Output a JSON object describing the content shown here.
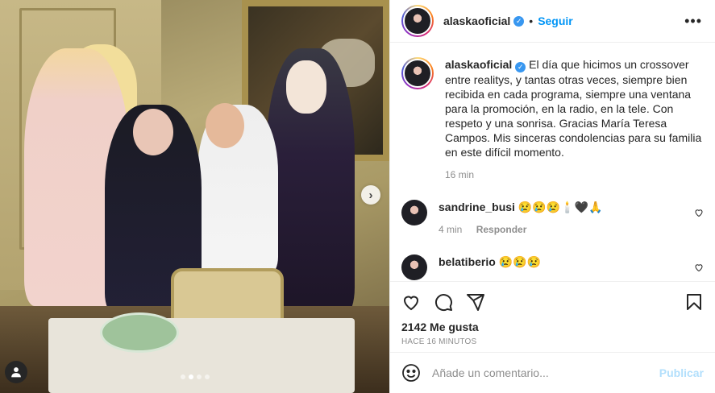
{
  "post": {
    "username": "alaskaoficial",
    "follow_label": "Seguir",
    "separator": "•",
    "more": "•••",
    "caption": "El día que hicimos un crossover entre realitys, y tantas otras veces, siempre bien recibida en cada programa, siempre una ventana para la promoción, en la radio, en la tele. Con respeto y una sonrisa. Gracias María Teresa Campos. Mis sinceras condolencias para su familia en este difícil momento.",
    "caption_time": "16 min",
    "likes": "2142 Me gusta",
    "posted": "HACE 16 MINUTOS",
    "carousel_next": "›",
    "slide_count": 4,
    "active_slide": 2
  },
  "comments": [
    {
      "username": "sandrine_busi",
      "text": "😢😢😢🕯️🖤🙏",
      "time": "4 min",
      "reply_label": "Responder"
    },
    {
      "username": "belatiberio",
      "text": "😢😢😢"
    }
  ],
  "add_comment": {
    "placeholder": "Añade un comentario...",
    "publish_label": "Publicar"
  },
  "icons": {
    "like": "heart-icon",
    "comment": "comment-icon",
    "share": "paper-plane-icon",
    "save": "bookmark-icon",
    "emoji": "emoji-icon",
    "tag": "user-tag-icon"
  },
  "colors": {
    "accent": "#0095f6",
    "verified": "#3897f0",
    "publish_disabled": "#b2dffc",
    "muted": "#8e8e8e"
  }
}
